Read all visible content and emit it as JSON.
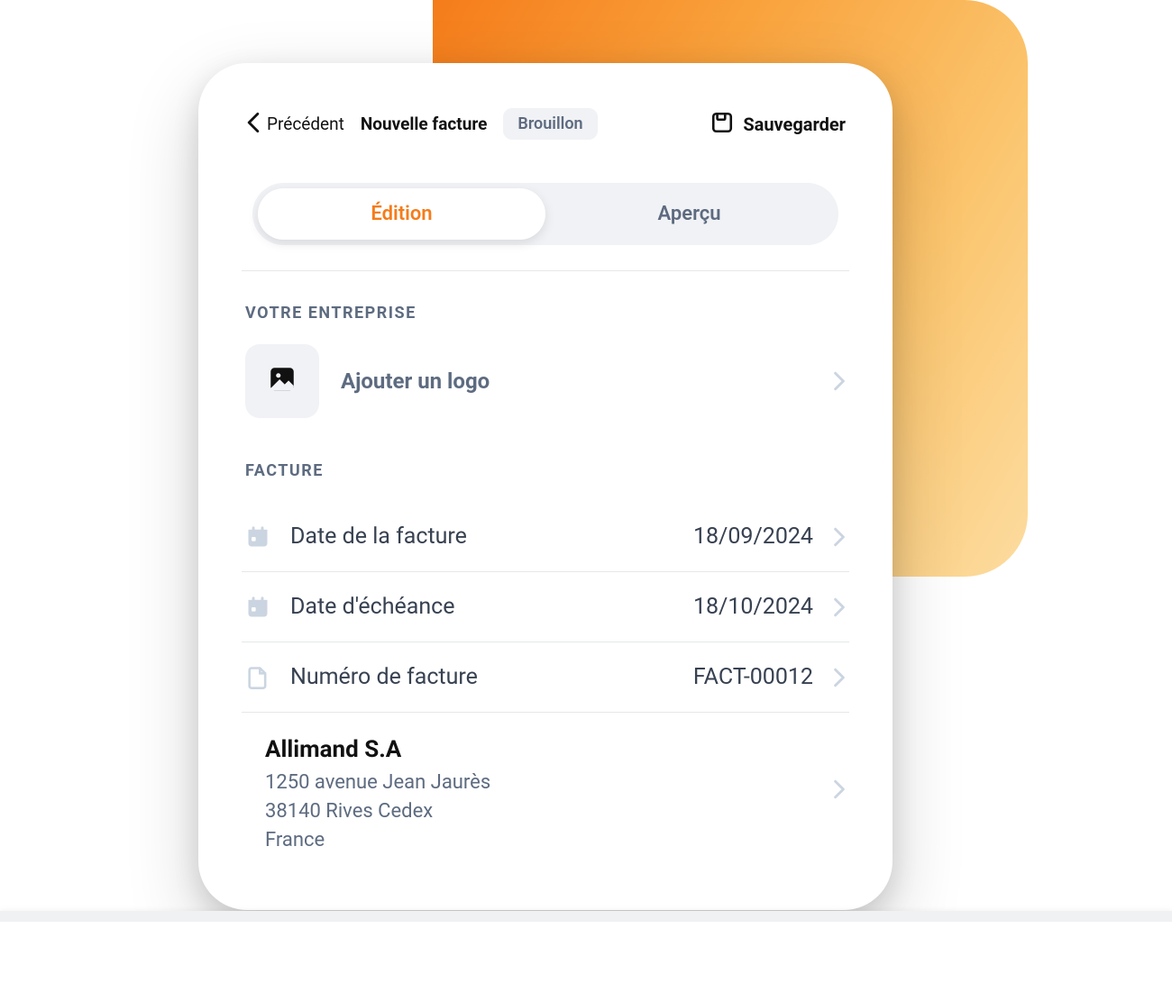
{
  "header": {
    "back_label": "Précédent",
    "title": "Nouvelle facture",
    "status_badge": "Brouillon",
    "save_label": "Sauvegarder"
  },
  "tabs": {
    "edit": "Édition",
    "preview": "Aperçu"
  },
  "sections": {
    "company_label": "VOTRE ENTREPRISE",
    "add_logo": "Ajouter un logo",
    "invoice_label": "FACTURE"
  },
  "invoice": {
    "date_label": "Date de la facture",
    "date_value": "18/09/2024",
    "due_label": "Date d'échéance",
    "due_value": "18/10/2024",
    "number_label": "Numéro de facture",
    "number_value": "FACT-00012"
  },
  "client": {
    "name": "Allimand S.A",
    "addr1": "1250 avenue Jean Jaurès",
    "addr2": "38140 Rives Cedex",
    "addr3": "France"
  },
  "colors": {
    "accent": "#f57c1a",
    "muted": "#5d6b80"
  }
}
